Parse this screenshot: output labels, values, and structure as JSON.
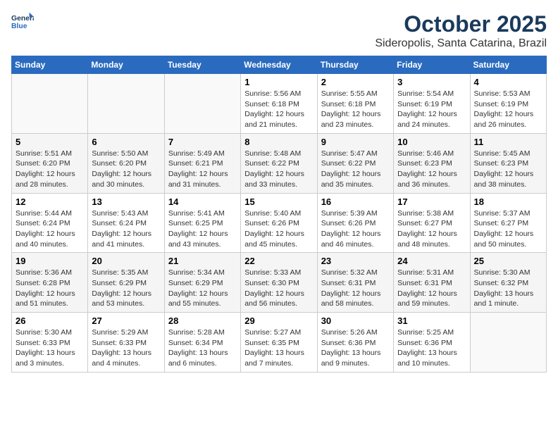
{
  "header": {
    "logo_line1": "General",
    "logo_line2": "Blue",
    "title": "October 2025",
    "subtitle": "Sideropolis, Santa Catarina, Brazil"
  },
  "days_of_week": [
    "Sunday",
    "Monday",
    "Tuesday",
    "Wednesday",
    "Thursday",
    "Friday",
    "Saturday"
  ],
  "weeks": [
    [
      {
        "day": "",
        "info": ""
      },
      {
        "day": "",
        "info": ""
      },
      {
        "day": "",
        "info": ""
      },
      {
        "day": "1",
        "info": "Sunrise: 5:56 AM\nSunset: 6:18 PM\nDaylight: 12 hours and 21 minutes."
      },
      {
        "day": "2",
        "info": "Sunrise: 5:55 AM\nSunset: 6:18 PM\nDaylight: 12 hours and 23 minutes."
      },
      {
        "day": "3",
        "info": "Sunrise: 5:54 AM\nSunset: 6:19 PM\nDaylight: 12 hours and 24 minutes."
      },
      {
        "day": "4",
        "info": "Sunrise: 5:53 AM\nSunset: 6:19 PM\nDaylight: 12 hours and 26 minutes."
      }
    ],
    [
      {
        "day": "5",
        "info": "Sunrise: 5:51 AM\nSunset: 6:20 PM\nDaylight: 12 hours and 28 minutes."
      },
      {
        "day": "6",
        "info": "Sunrise: 5:50 AM\nSunset: 6:20 PM\nDaylight: 12 hours and 30 minutes."
      },
      {
        "day": "7",
        "info": "Sunrise: 5:49 AM\nSunset: 6:21 PM\nDaylight: 12 hours and 31 minutes."
      },
      {
        "day": "8",
        "info": "Sunrise: 5:48 AM\nSunset: 6:22 PM\nDaylight: 12 hours and 33 minutes."
      },
      {
        "day": "9",
        "info": "Sunrise: 5:47 AM\nSunset: 6:22 PM\nDaylight: 12 hours and 35 minutes."
      },
      {
        "day": "10",
        "info": "Sunrise: 5:46 AM\nSunset: 6:23 PM\nDaylight: 12 hours and 36 minutes."
      },
      {
        "day": "11",
        "info": "Sunrise: 5:45 AM\nSunset: 6:23 PM\nDaylight: 12 hours and 38 minutes."
      }
    ],
    [
      {
        "day": "12",
        "info": "Sunrise: 5:44 AM\nSunset: 6:24 PM\nDaylight: 12 hours and 40 minutes."
      },
      {
        "day": "13",
        "info": "Sunrise: 5:43 AM\nSunset: 6:24 PM\nDaylight: 12 hours and 41 minutes."
      },
      {
        "day": "14",
        "info": "Sunrise: 5:41 AM\nSunset: 6:25 PM\nDaylight: 12 hours and 43 minutes."
      },
      {
        "day": "15",
        "info": "Sunrise: 5:40 AM\nSunset: 6:26 PM\nDaylight: 12 hours and 45 minutes."
      },
      {
        "day": "16",
        "info": "Sunrise: 5:39 AM\nSunset: 6:26 PM\nDaylight: 12 hours and 46 minutes."
      },
      {
        "day": "17",
        "info": "Sunrise: 5:38 AM\nSunset: 6:27 PM\nDaylight: 12 hours and 48 minutes."
      },
      {
        "day": "18",
        "info": "Sunrise: 5:37 AM\nSunset: 6:27 PM\nDaylight: 12 hours and 50 minutes."
      }
    ],
    [
      {
        "day": "19",
        "info": "Sunrise: 5:36 AM\nSunset: 6:28 PM\nDaylight: 12 hours and 51 minutes."
      },
      {
        "day": "20",
        "info": "Sunrise: 5:35 AM\nSunset: 6:29 PM\nDaylight: 12 hours and 53 minutes."
      },
      {
        "day": "21",
        "info": "Sunrise: 5:34 AM\nSunset: 6:29 PM\nDaylight: 12 hours and 55 minutes."
      },
      {
        "day": "22",
        "info": "Sunrise: 5:33 AM\nSunset: 6:30 PM\nDaylight: 12 hours and 56 minutes."
      },
      {
        "day": "23",
        "info": "Sunrise: 5:32 AM\nSunset: 6:31 PM\nDaylight: 12 hours and 58 minutes."
      },
      {
        "day": "24",
        "info": "Sunrise: 5:31 AM\nSunset: 6:31 PM\nDaylight: 12 hours and 59 minutes."
      },
      {
        "day": "25",
        "info": "Sunrise: 5:30 AM\nSunset: 6:32 PM\nDaylight: 13 hours and 1 minute."
      }
    ],
    [
      {
        "day": "26",
        "info": "Sunrise: 5:30 AM\nSunset: 6:33 PM\nDaylight: 13 hours and 3 minutes."
      },
      {
        "day": "27",
        "info": "Sunrise: 5:29 AM\nSunset: 6:33 PM\nDaylight: 13 hours and 4 minutes."
      },
      {
        "day": "28",
        "info": "Sunrise: 5:28 AM\nSunset: 6:34 PM\nDaylight: 13 hours and 6 minutes."
      },
      {
        "day": "29",
        "info": "Sunrise: 5:27 AM\nSunset: 6:35 PM\nDaylight: 13 hours and 7 minutes."
      },
      {
        "day": "30",
        "info": "Sunrise: 5:26 AM\nSunset: 6:36 PM\nDaylight: 13 hours and 9 minutes."
      },
      {
        "day": "31",
        "info": "Sunrise: 5:25 AM\nSunset: 6:36 PM\nDaylight: 13 hours and 10 minutes."
      },
      {
        "day": "",
        "info": ""
      }
    ]
  ]
}
